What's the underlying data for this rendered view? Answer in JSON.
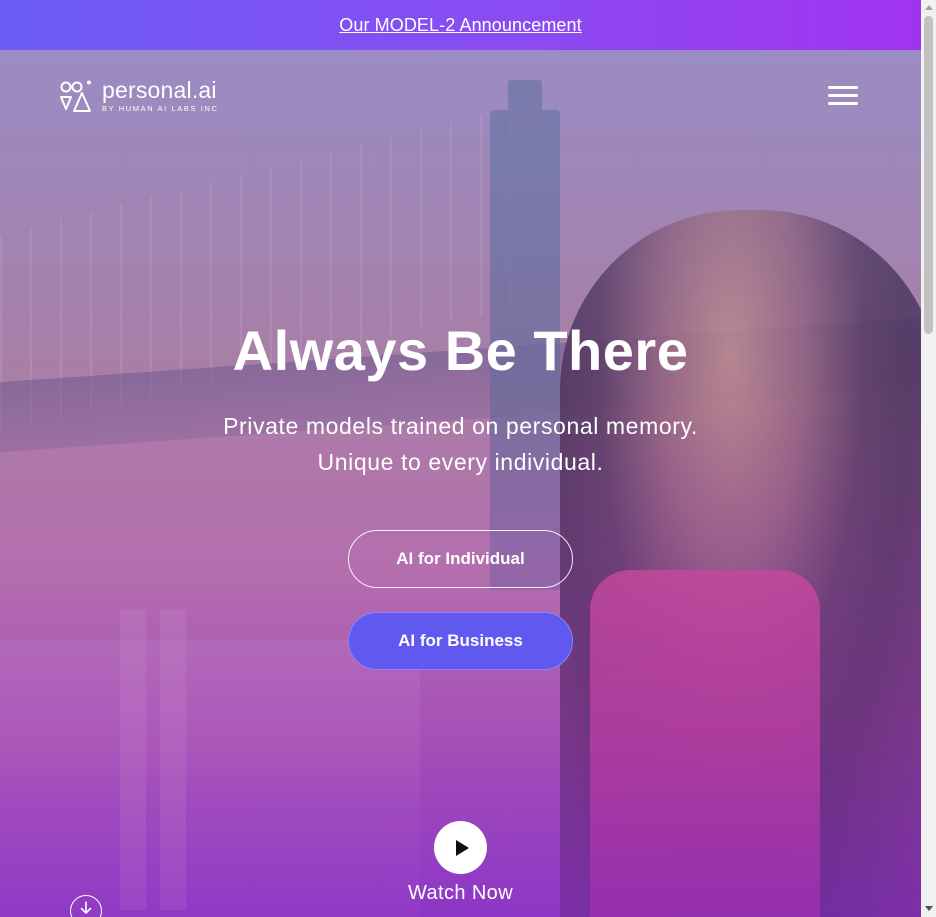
{
  "announcement": {
    "link_text": "Our MODEL-2 Announcement"
  },
  "brand": {
    "name": "personal.ai",
    "tagline": "BY HUMAN AI LABS INC"
  },
  "hero": {
    "title": "Always Be There",
    "subtitle_line1": "Private models trained on personal memory.",
    "subtitle_line2": "Unique to every individual.",
    "primary_cta": "AI for Individual",
    "secondary_cta": "AI for Business",
    "video_label": "Watch Now"
  },
  "icons": {
    "logo": "logo-mark-icon",
    "menu": "hamburger-menu-icon",
    "play": "play-icon",
    "scroll": "arrow-down-icon"
  },
  "colors": {
    "announcement_start": "#6a5bf5",
    "announcement_end": "#a133ef",
    "business_button": "#6158f0",
    "text": "#ffffff"
  }
}
